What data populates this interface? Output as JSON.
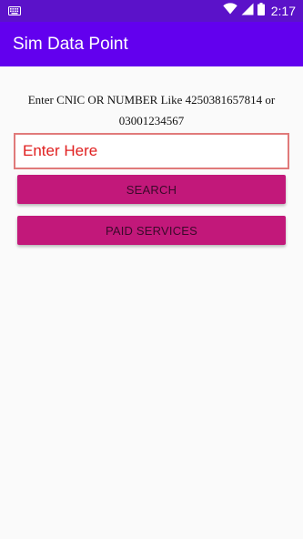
{
  "status_bar": {
    "time": "2:17",
    "icons": [
      "keyboard-icon",
      "wifi-icon",
      "cell-signal-icon",
      "battery-icon"
    ]
  },
  "app_bar": {
    "title": "Sim Data Point",
    "color": "#6200ee"
  },
  "main": {
    "instruction": "Enter CNIC OR NUMBER Like 4250381657814 or 03001234567",
    "search_input": {
      "value": "",
      "placeholder": "Enter Here"
    },
    "search_button_label": "SEARCH",
    "paid_services_button_label": "PAID SERVICES",
    "button_color": "#c2187a"
  }
}
